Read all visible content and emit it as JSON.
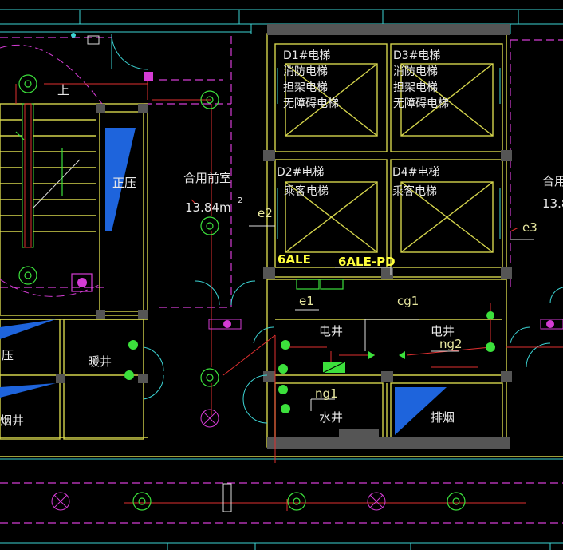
{
  "drawing": {
    "rooms": {
      "elevator_d1": [
        "D1#电梯",
        "消防电梯",
        "担架电梯",
        "无障碍电梯"
      ],
      "elevator_d3": [
        "D3#电梯",
        "消防电梯",
        "担架电梯",
        "无障碍电梯"
      ],
      "elevator_d2": [
        "D2#电梯",
        "乘客电梯"
      ],
      "elevator_d4": [
        "D4#电梯",
        "乘客电梯"
      ],
      "front_room": [
        "合用前室",
        "13.84m",
        "2"
      ],
      "front_room_right": [
        "合用",
        "13.8"
      ],
      "stair_up": "上",
      "pressure": "正压",
      "pressure_left": "压",
      "smoke_left": "烟井",
      "heating_shaft": "暖井",
      "elec_shaft_1": "电井",
      "elec_shaft_2": "电井",
      "water_shaft": "水井",
      "smoke_exhaust": "排烟"
    },
    "tags": {
      "e1": "e1",
      "e2": "e2",
      "e3": "e3",
      "cg1": "cg1",
      "ng1": "ng1",
      "ng2": "ng2"
    },
    "panels": {
      "ale": "6ALE",
      "ale_pd": "6ALE-PD"
    },
    "colors": {
      "walls": "#d4d44c",
      "grid": "#3cd4d4",
      "dashed": "#d43cd4",
      "wiring": "#e03030",
      "fixtures": "#3ce03c",
      "labels_highlight": "#ffff3c",
      "fill_blue": "#1e64dc"
    }
  }
}
